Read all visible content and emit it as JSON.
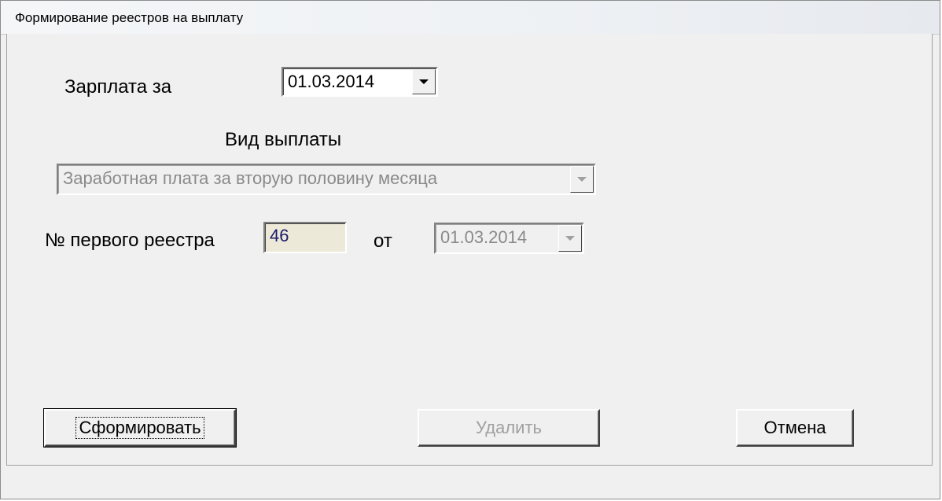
{
  "window": {
    "title": "Формирование реестров на выплату"
  },
  "salary_for": {
    "label": "Зарплата за",
    "value": "01.03.2014"
  },
  "payment_type": {
    "label": "Вид выплаты",
    "value": "Заработная плата за вторую половину месяца"
  },
  "first_register": {
    "label": "№ первого реестра",
    "number": "46",
    "from_label": "от",
    "date": "01.03.2014"
  },
  "buttons": {
    "form": "Сформировать",
    "delete": "Удалить",
    "cancel": "Отмена"
  },
  "colors": {
    "window_bg": "#f0f0f0",
    "edit_bg": "#ece9d8",
    "disabled_text": "#8a8a8a"
  },
  "icons": {
    "dropdown": "chevron-down-icon"
  }
}
